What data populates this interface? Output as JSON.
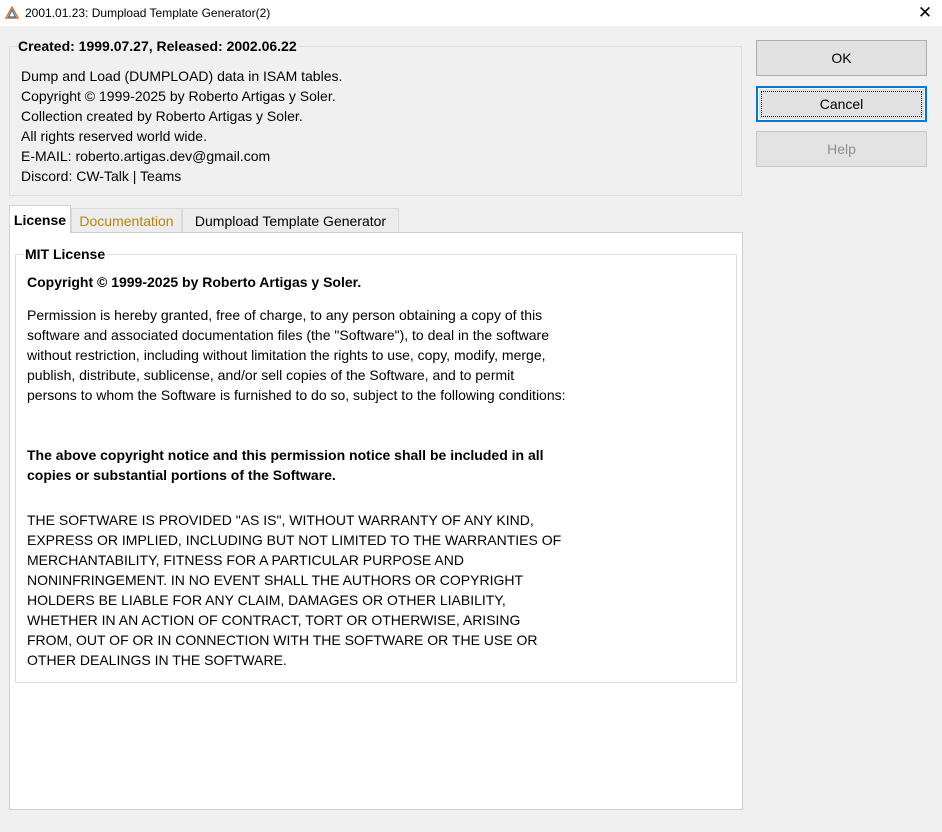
{
  "window": {
    "title": "2001.01.23: Dumpload Template Generator(2)",
    "close_glyph": "✕",
    "icon": "app-triangle-icon"
  },
  "header": {
    "group_title": "Created: 1999.07.27, Released: 2002.06.22",
    "lines": [
      "Dump and Load (DUMPLOAD) data in ISAM tables.",
      "Copyright © 1999-2025 by Roberto Artigas y Soler.",
      "Collection created by Roberto Artigas y Soler.",
      "All rights reserved world wide.",
      "E-MAIL: roberto.artigas.dev@gmail.com",
      "Discord: CW-Talk | Teams"
    ]
  },
  "buttons": {
    "ok": "OK",
    "cancel": "Cancel",
    "help": "Help"
  },
  "tabs": [
    {
      "label": "License",
      "active": true
    },
    {
      "label": "Documentation",
      "active": false
    },
    {
      "label": "Dumpload Template Generator",
      "active": false
    }
  ],
  "license": {
    "group_title": "MIT License",
    "copyright": "Copyright © 1999-2025 by Roberto Artigas y Soler.",
    "permission": "Permission is hereby granted, free of charge, to any person obtaining a copy of this software and associated documentation files (the \"Software\"), to deal in the software without restriction, including without limitation the rights to use, copy, modify, merge, publish, distribute, sublicense, and/or sell copies of the Software, and to permit persons to whom the Software is furnished to do so, subject to the following conditions:",
    "notice": "The above copyright notice and this permission notice shall be included in all copies or substantial portions of the Software.",
    "warranty": "THE SOFTWARE IS PROVIDED \"AS IS\", WITHOUT WARRANTY OF ANY KIND, EXPRESS OR IMPLIED, INCLUDING BUT NOT LIMITED TO THE WARRANTIES OF MERCHANTABILITY, FITNESS FOR A PARTICULAR PURPOSE AND NONINFRINGEMENT. IN NO EVENT SHALL THE AUTHORS OR COPYRIGHT HOLDERS BE LIABLE FOR ANY CLAIM, DAMAGES OR OTHER LIABILITY, WHETHER IN AN ACTION OF CONTRACT, TORT OR OTHERWISE, ARISING FROM, OUT OF OR IN CONNECTION WITH THE SOFTWARE OR THE USE OR OTHER DEALINGS IN THE SOFTWARE."
  },
  "colors": {
    "focus_border": "#0078d7",
    "doc_tab_text": "#b8860b",
    "disabled_text": "#8e8e8e"
  }
}
